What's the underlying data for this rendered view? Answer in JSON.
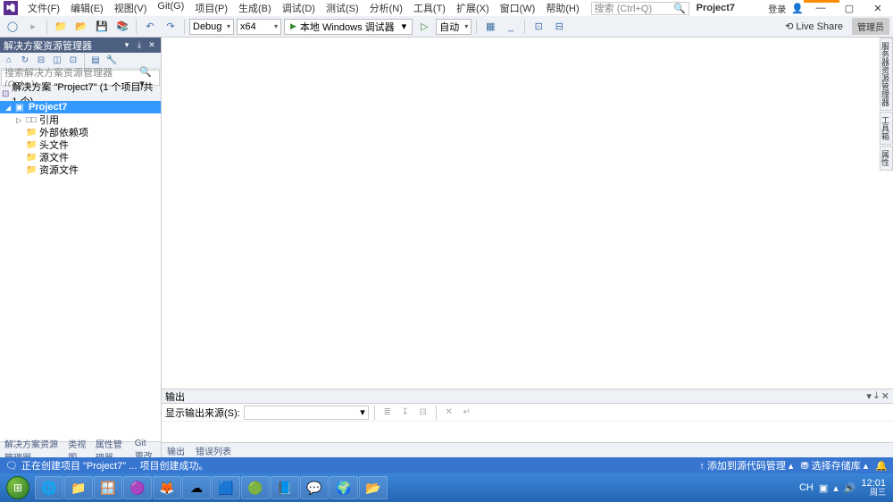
{
  "menu": [
    "文件(F)",
    "编辑(E)",
    "视图(V)",
    "Git(G)",
    "项目(P)",
    "生成(B)",
    "调试(D)",
    "测试(S)",
    "分析(N)",
    "工具(T)",
    "扩展(X)",
    "窗口(W)",
    "帮助(H)"
  ],
  "title_search_placeholder": "搜索 (Ctrl+Q)",
  "title_project": "Project7",
  "login_label": "登录",
  "toolbar": {
    "config": "Debug",
    "platform": "x64",
    "debug_label": "本地 Windows 调试器",
    "auto_label": "自动"
  },
  "liveshare": "Live Share",
  "admin_label": "管理员",
  "solution_explorer": {
    "title": "解决方案资源管理器",
    "search_placeholder": "搜索解决方案资源管理器(Ctrl+;)",
    "solution_line": "解决方案 \"Project7\" (1 个项目/共 1 个)",
    "project": "Project7",
    "nodes": [
      "引用",
      "外部依赖项",
      "头文件",
      "源文件",
      "资源文件"
    ],
    "ref_prefix": "□□",
    "tabs": [
      "解决方案资源管理器",
      "类视图",
      "属性管理器",
      "Git 更改"
    ]
  },
  "output": {
    "title": "输出",
    "show_from_label": "显示输出来源(S):",
    "tabs": [
      "输出",
      "错误列表"
    ]
  },
  "right_tabs": [
    "服务器资源管理器",
    "工具箱",
    "属性"
  ],
  "status": {
    "text": "正在创建项目 \"Project7\" ... 项目创建成功。",
    "add_source": "添加到源代码管理",
    "select_repo": "选择存储库"
  },
  "tray": {
    "ime": "CH",
    "time": "12:01",
    "date": "周三"
  }
}
